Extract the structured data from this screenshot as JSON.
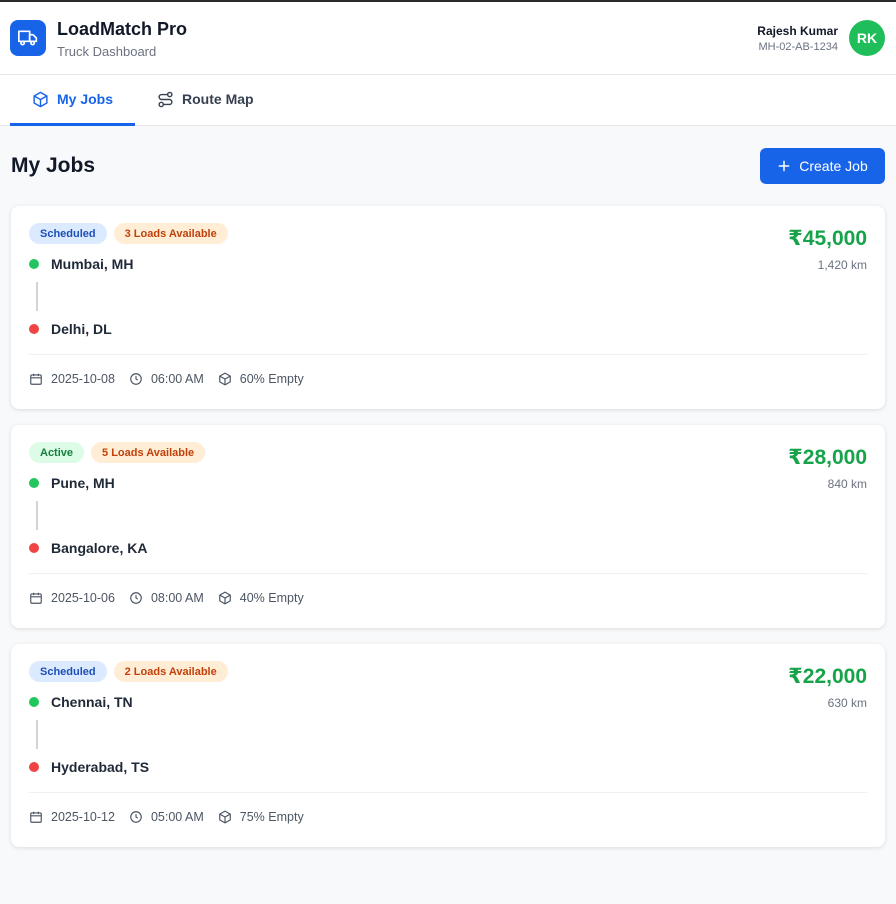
{
  "app": {
    "title": "LoadMatch Pro",
    "subtitle": "Truck Dashboard"
  },
  "user": {
    "name": "Rajesh Kumar",
    "plate": "MH-02-AB-1234",
    "initials": "RK"
  },
  "tabs": [
    {
      "label": "My Jobs",
      "icon": "box-icon",
      "active": true
    },
    {
      "label": "Route Map",
      "icon": "route-icon",
      "active": false
    }
  ],
  "page": {
    "title": "My Jobs",
    "create_label": "Create Job"
  },
  "jobs": [
    {
      "status": "Scheduled",
      "loads": "3 Loads Available",
      "price": "₹45,000",
      "distance": "1,420 km",
      "origin": "Mumbai, MH",
      "destination": "Delhi, DL",
      "date": "2025-10-08",
      "time": "06:00 AM",
      "empty": "60% Empty"
    },
    {
      "status": "Active",
      "loads": "5 Loads Available",
      "price": "₹28,000",
      "distance": "840 km",
      "origin": "Pune, MH",
      "destination": "Bangalore, KA",
      "date": "2025-10-06",
      "time": "08:00 AM",
      "empty": "40% Empty"
    },
    {
      "status": "Scheduled",
      "loads": "2 Loads Available",
      "price": "₹22,000",
      "distance": "630 km",
      "origin": "Chennai, TN",
      "destination": "Hyderabad, TS",
      "date": "2025-10-12",
      "time": "05:00 AM",
      "empty": "75% Empty"
    }
  ],
  "colors": {
    "primary": "#1864e8",
    "price": "#16a34a",
    "origin": "#22c55e",
    "destination": "#ef4444",
    "avatar": "#1fbe5b"
  }
}
